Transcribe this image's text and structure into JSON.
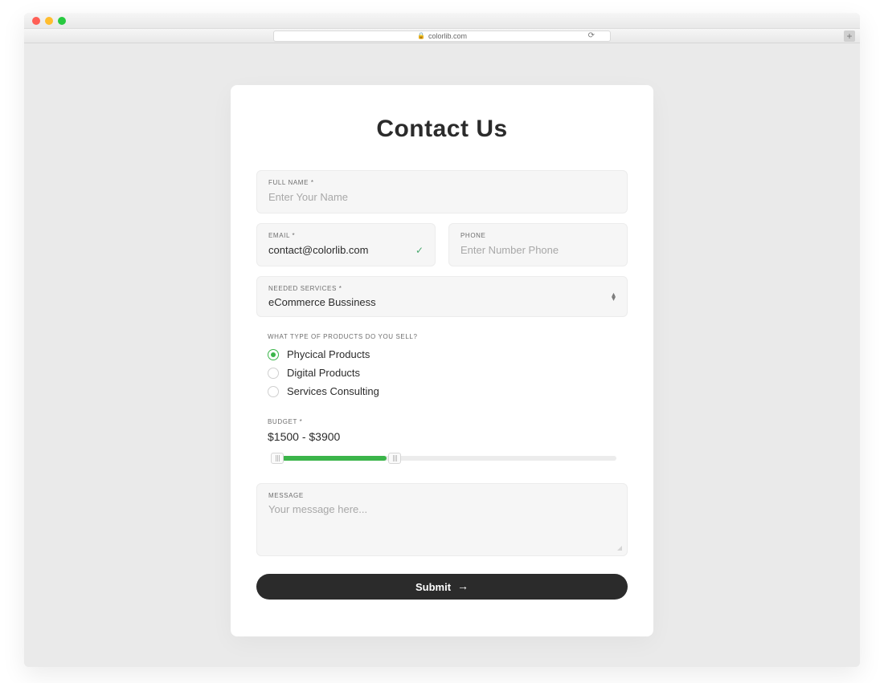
{
  "browser": {
    "url_host": "colorlib.com"
  },
  "form": {
    "title": "Contact Us",
    "full_name": {
      "label": "FULL NAME *",
      "placeholder": "Enter Your Name",
      "value": ""
    },
    "email": {
      "label": "EMAIL *",
      "placeholder": "",
      "value": "contact@colorlib.com",
      "valid": true
    },
    "phone": {
      "label": "PHONE",
      "placeholder": "Enter Number Phone",
      "value": ""
    },
    "services": {
      "label": "NEEDED SERVICES *",
      "value": "eCommerce Bussiness"
    },
    "products": {
      "label": "WHAT TYPE OF PRODUCTS DO YOU SELL?",
      "options": [
        {
          "label": "Phycical Products",
          "selected": true
        },
        {
          "label": "Digital Products",
          "selected": false
        },
        {
          "label": "Services Consulting",
          "selected": false
        }
      ]
    },
    "budget": {
      "label": "BUDGET *",
      "display": "$1500 - $3900"
    },
    "message": {
      "label": "MESSAGE",
      "placeholder": "Your message here...",
      "value": ""
    },
    "submit_label": "Submit"
  }
}
